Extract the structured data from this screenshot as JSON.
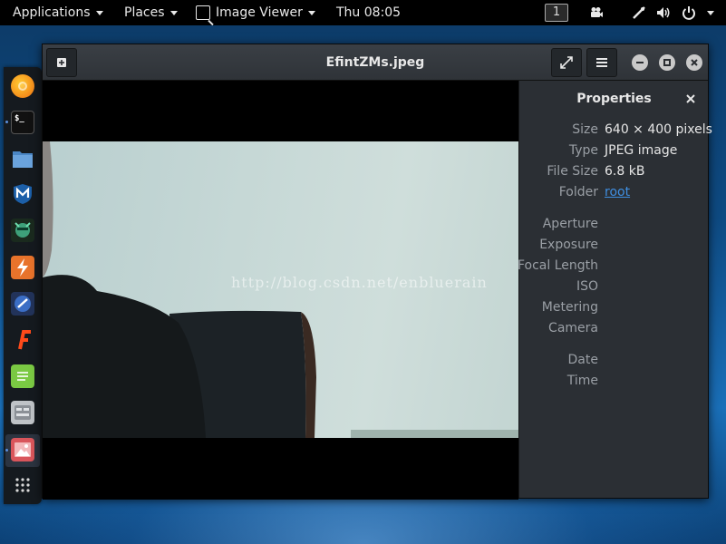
{
  "topbar": {
    "applications": "Applications",
    "places": "Places",
    "app_name": "Image Viewer",
    "clock": "Thu 08:05",
    "workspace": "1"
  },
  "dock": {
    "items": [
      "firefox-icon",
      "terminal-icon",
      "files-icon",
      "metasploit-icon",
      "armitage-icon",
      "burpsuite-icon",
      "beef-icon",
      "faraday-icon",
      "notes-icon",
      "settings-icon",
      "image-viewer-icon",
      "app-grid-icon"
    ],
    "terminal_label": "$_"
  },
  "window": {
    "title": "EfintZMs.jpeg"
  },
  "image": {
    "watermark": "http://blog.csdn.net/enbluerain"
  },
  "properties": {
    "title": "Properties",
    "fields": [
      {
        "key": "Size",
        "value": "640 × 400 pixels"
      },
      {
        "key": "Type",
        "value": "JPEG image"
      },
      {
        "key": "File Size",
        "value": "6.8 kB"
      },
      {
        "key": "Folder",
        "value": "root"
      }
    ],
    "exif_fields": [
      "Aperture",
      "Exposure",
      "Focal Length",
      "ISO",
      "Metering",
      "Camera"
    ],
    "date_fields": [
      "Date",
      "Time"
    ]
  },
  "colors": {
    "link": "#3f8ee0",
    "sidebar_bg": "#2b2f34",
    "headerbar_bg": "#3a3f45"
  }
}
